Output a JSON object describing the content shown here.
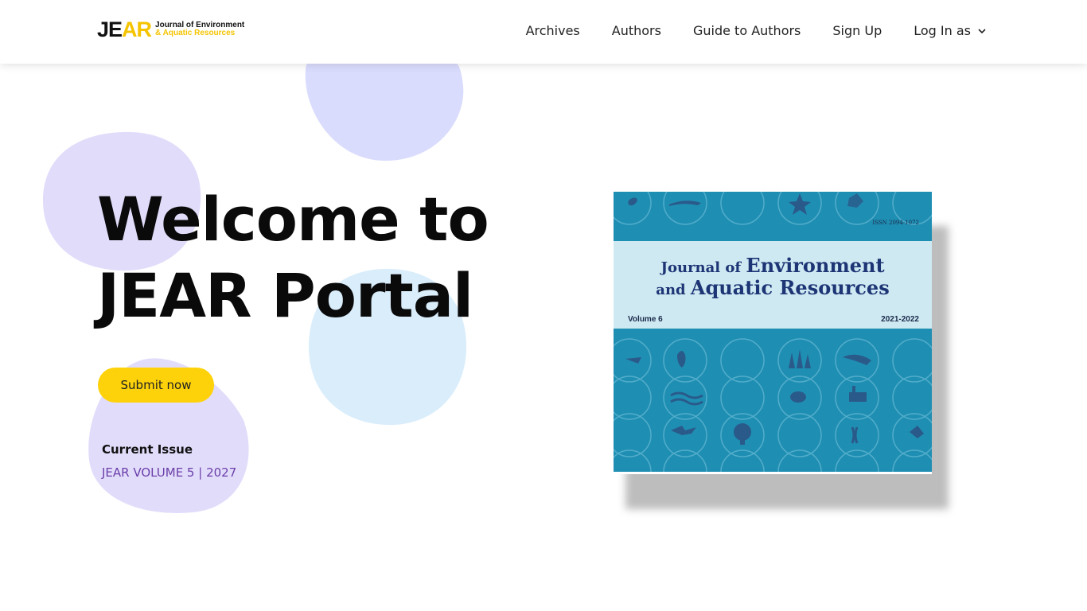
{
  "header": {
    "logo": {
      "mark_je": "JE",
      "mark_ar": "AR",
      "line1": "Journal of Environment",
      "line2": "& Aquatic Resources"
    },
    "nav": [
      "Archives",
      "Authors",
      "Guide to Authors",
      "Sign Up",
      "Log In as"
    ]
  },
  "hero": {
    "title_line1": "Welcome to",
    "title_line2": "JEAR Portal",
    "submit_label": "Submit now",
    "current_issue_label": "Current Issue",
    "current_issue_link": "JEAR VOLUME 5 | 2027"
  },
  "cover": {
    "issn": "ISSN  2094-1072",
    "title_line1_small": "Journal of ",
    "title_line1_big": "Environment",
    "title_line2_small": "and ",
    "title_line2_big": "Aquatic Resources",
    "volume": "Volume 6",
    "years": "2021-2022"
  },
  "colors": {
    "accent_yellow": "#fdd20a",
    "link_purple": "#6a3ea8",
    "cover_blue": "#1f8eb3",
    "blob_lavender": "#e0dcfb",
    "blob_blue": "#d8ecfb"
  }
}
